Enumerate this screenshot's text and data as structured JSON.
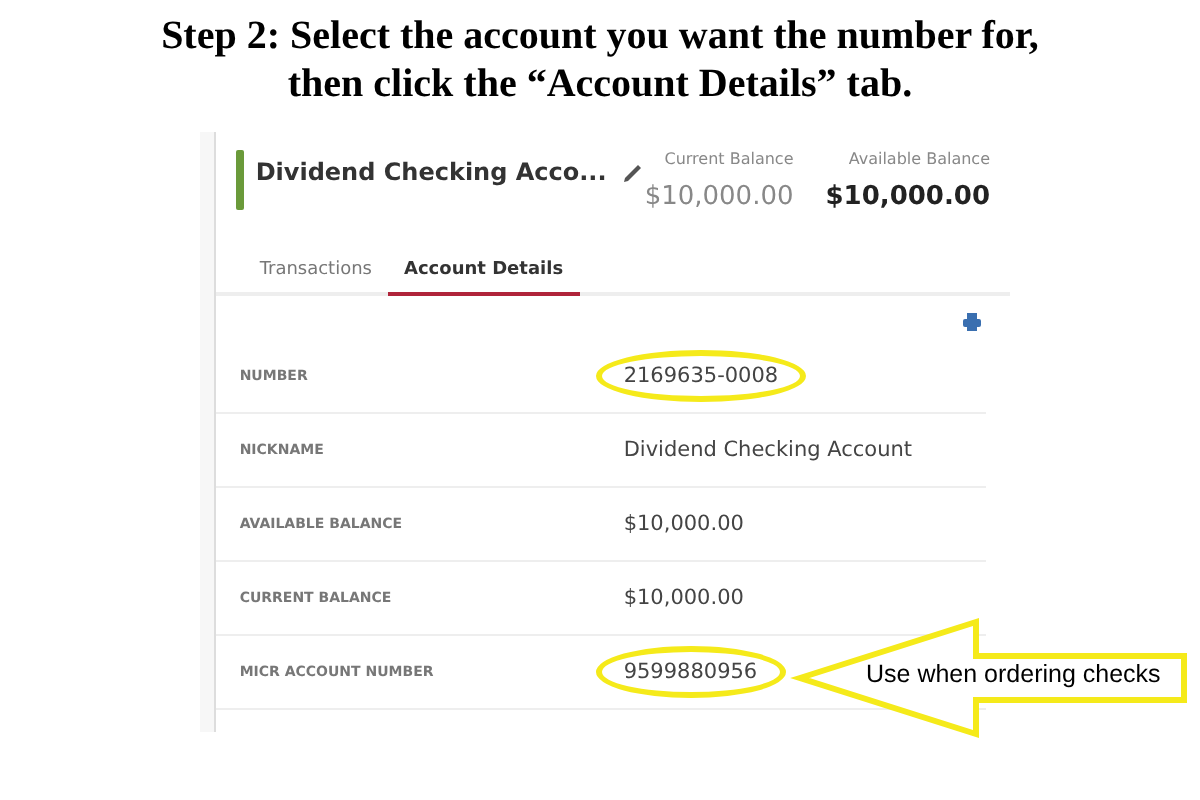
{
  "heading": [
    "Step 2: Select the account you want the number for,",
    "then click the “Account Details” tab."
  ],
  "account": {
    "name": "Dividend Checking Acco...",
    "color": "#6a9a3a",
    "balances": [
      {
        "label": "Current Balance",
        "value": "$10,000.00",
        "emphasis": false
      },
      {
        "label": "Available Balance",
        "value": "$10,000.00",
        "emphasis": true
      }
    ]
  },
  "tabs": [
    {
      "label": "Transactions",
      "selected": false
    },
    {
      "label": "Account Details",
      "selected": true
    }
  ],
  "details": [
    {
      "label": "NUMBER",
      "value": "2169635-0008",
      "highlighted": true
    },
    {
      "label": "NICKNAME",
      "value": "Dividend Checking Account",
      "highlighted": false
    },
    {
      "label": "AVAILABLE BALANCE",
      "value": "$10,000.00",
      "highlighted": false
    },
    {
      "label": "CURRENT BALANCE",
      "value": "$10,000.00",
      "highlighted": false
    },
    {
      "label": "MICR ACCOUNT NUMBER",
      "value": "9599880956",
      "highlighted": true
    }
  ],
  "callout": "Use when ordering checks"
}
